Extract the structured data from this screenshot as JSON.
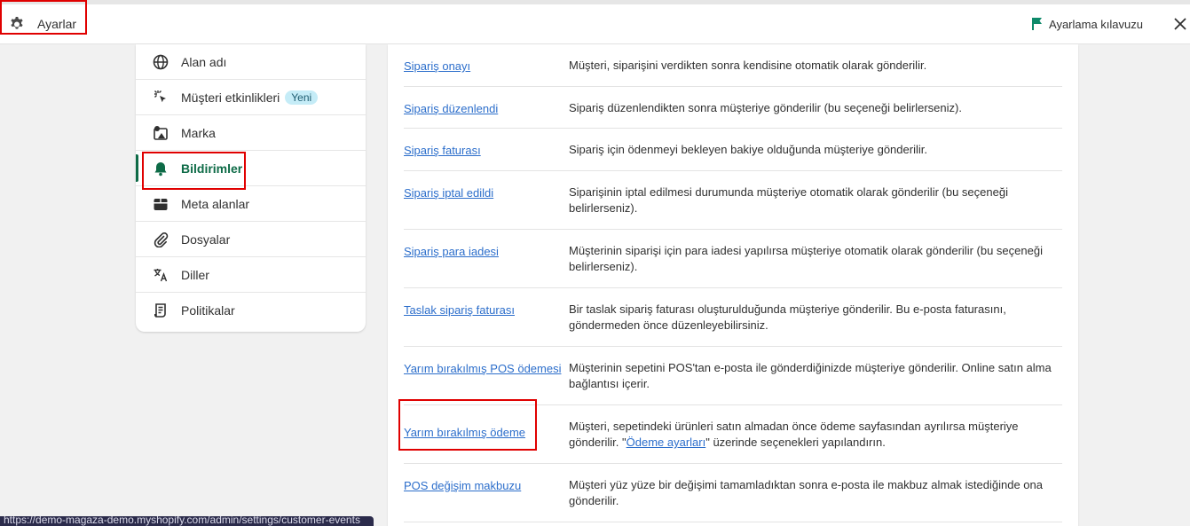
{
  "header": {
    "title": "Ayarlar",
    "guide_label": "Ayarlama kılavuzu",
    "accent": "#0e6b47"
  },
  "sidebar": {
    "items": [
      {
        "label": "Alan adı",
        "icon": "globe-icon"
      },
      {
        "label": "Müşteri etkinlikleri",
        "icon": "cursor-sparkle-icon",
        "badge": "Yeni"
      },
      {
        "label": "Marka",
        "icon": "brand-icon"
      },
      {
        "label": "Bildirimler",
        "icon": "bell-icon",
        "active": true
      },
      {
        "label": "Meta alanlar",
        "icon": "metafields-icon"
      },
      {
        "label": "Dosyalar",
        "icon": "paperclip-icon"
      },
      {
        "label": "Diller",
        "icon": "translate-icon"
      },
      {
        "label": "Politikalar",
        "icon": "policy-icon"
      }
    ]
  },
  "notifications": [
    {
      "title": "Sipariş onayı",
      "desc": "Müşteri, siparişini verdikten sonra kendisine otomatik olarak gönderilir."
    },
    {
      "title": "Sipariş düzenlendi",
      "desc": "Sipariş düzenlendikten sonra müşteriye gönderilir (bu seçeneği belirlerseniz)."
    },
    {
      "title": "Sipariş faturası",
      "desc": "Sipariş için ödenmeyi bekleyen bakiye olduğunda müşteriye gönderilir."
    },
    {
      "title": "Sipariş iptal edildi",
      "desc": "Siparişinin iptal edilmesi durumunda müşteriye otomatik olarak gönderilir (bu seçeneği belirlerseniz)."
    },
    {
      "title": "Sipariş para iadesi",
      "desc": "Müşterinin siparişi için para iadesi yapılırsa müşteriye otomatik olarak gönderilir (bu seçeneği belirlerseniz)."
    },
    {
      "title": "Taslak sipariş faturası",
      "desc": "Bir taslak sipariş faturası oluşturulduğunda müşteriye gönderilir. Bu e-posta faturasını, göndermeden önce düzenleyebilirsiniz."
    },
    {
      "title": "Yarım bırakılmış POS ödemesi",
      "desc": "Müşterinin sepetini POS'tan e-posta ile gönderdiğinizde müşteriye gönderilir. Online satın alma bağlantısı içerir."
    },
    {
      "title": "Yarım bırakılmış ödeme",
      "desc": "Müşteri, sepetindeki ürünleri satın almadan önce ödeme sayfasından ayrılırsa müşteriye gönderilir.",
      "desc_pre": "\"",
      "desc_link": "Ödeme ayarları",
      "desc_post": "\" üzerinde seçenekleri yapılandırın."
    },
    {
      "title": "POS değişim makbuzu",
      "desc": "Müşteri yüz yüze bir değişimi tamamladıktan sonra e-posta ile makbuz almak istediğinde ona gönderilir."
    }
  ],
  "status_url": "https://demo-magaza-demo.myshopify.com/admin/settings/customer-events"
}
